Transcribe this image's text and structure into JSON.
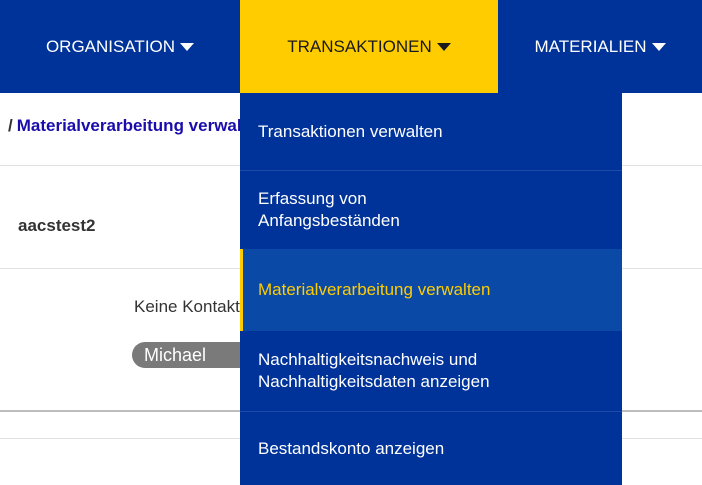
{
  "topnav": {
    "items": [
      {
        "label": "ORGANISATION",
        "active": false
      },
      {
        "label": "TRANSAKTIONEN",
        "active": true
      },
      {
        "label": "MATERIALIEN",
        "active": false
      }
    ]
  },
  "breadcrumb": {
    "separator": "/",
    "current": "Materialverarbeitung verwalten"
  },
  "user": {
    "name": "aacstest2",
    "contact_text": "Keine Kontaktdaten",
    "pill": "Michael"
  },
  "dropdown": {
    "items": [
      {
        "label": "Transaktionen verwalten"
      },
      {
        "label": "Erfassung von\nAnfangsbeständen"
      },
      {
        "label": "Materialverarbeitung verwalten",
        "active": true
      },
      {
        "label": "Nachhaltigkeitsnachweis und\nNachhaltigkeitsdaten anzeigen"
      },
      {
        "label": "Bestandskonto anzeigen"
      }
    ]
  },
  "colors": {
    "nav_bg": "#003399",
    "nav_active_bg": "#ffcc00",
    "active_text": "#ffcc00",
    "link": "#1a0dab"
  }
}
